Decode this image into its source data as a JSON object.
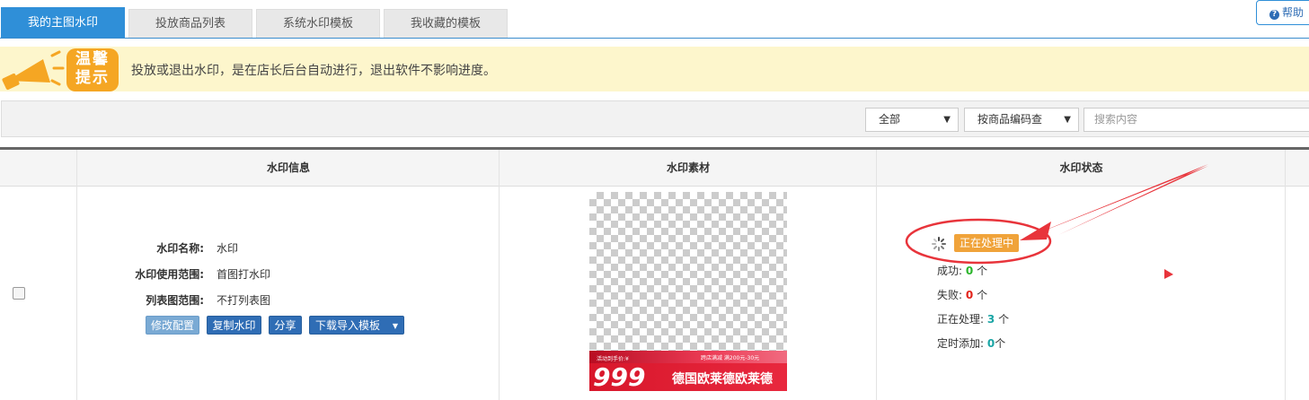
{
  "tabs": [
    {
      "label": "我的主图水印",
      "active": true
    },
    {
      "label": "投放商品列表",
      "active": false
    },
    {
      "label": "系统水印模板",
      "active": false
    },
    {
      "label": "我收藏的模板",
      "active": false
    }
  ],
  "help_label": "帮助",
  "notice": {
    "badge": "温馨提示",
    "text": "投放或退出水印，是在店长后台自动进行，退出软件不影响进度。"
  },
  "filters": {
    "scope_selected": "全部",
    "field_selected": "按商品编码查",
    "search_placeholder": "搜索内容"
  },
  "table": {
    "headers": [
      "水印信息",
      "水印素材",
      "水印状态"
    ],
    "row": {
      "info": [
        {
          "label": "水印名称:",
          "value": "水印"
        },
        {
          "label": "水印使用范围:",
          "value": "首图打水印"
        },
        {
          "label": "列表图范围:",
          "value": "不打列表图"
        }
      ],
      "buttons": {
        "edit": "修改配置",
        "copy": "复制水印",
        "share": "分享",
        "download": "下载导入模板"
      },
      "material": {
        "small_left": "活动到手价:¥",
        "small_right": "跨店满减 满200元-30元",
        "price": "999",
        "name": "德国欧莱德欧莱德"
      },
      "status": {
        "badge": "正在处理中",
        "success_label": "成功:",
        "success_count": "0",
        "success_unit": "个",
        "fail_label": "失败:",
        "fail_count": "0",
        "fail_unit": "个",
        "processing_label": "正在处理:",
        "processing_count": "3",
        "processing_unit": "个",
        "scheduled_label": "定时添加:",
        "scheduled_count": "0",
        "scheduled_unit": "个"
      }
    }
  },
  "colors": {
    "accent": "#2f8fd8",
    "badge": "#f0a33a",
    "annotation": "#e8343b"
  }
}
